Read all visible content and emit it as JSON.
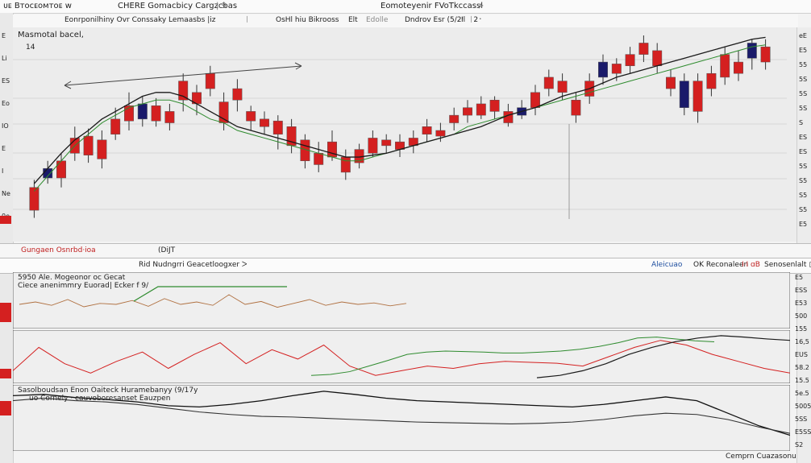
{
  "toolbar": {
    "left_title": "ᴜᴇ Bᴛoᴄᴇoᴍᴛoᴇ ᴡ",
    "center_title": "CHERE Gomacbicy Cargzcbas",
    "pager": "| 9",
    "right_title": "Eomoteyenir FVoTkccassl",
    "right_mark": "≯"
  },
  "header2": {
    "a": "Eonrponilhiny Ovr Conssaky Lemaasbs |iz",
    "b": "ᛁ",
    "c": "OsHl hiu Bikrooss",
    "d": "Elt",
    "e": "Edolle",
    "f": "Dndrov Esr (5/2ᶦ",
    "g": "Il",
    "h": "ᛁ2᛫"
  },
  "main_panel": {
    "label": "Masmotal bacel,",
    "sublabel": "14"
  },
  "sep1": {
    "left": "Gungaen Osnrbd·ioa",
    "mid": "(DiJT",
    "center": "Rid Nudngrri Geacetloogxer  ᐳ",
    "right_blue": "Aleicuao",
    "right_a": "OK Reconaleen",
    "right_b": "I·I ɑB",
    "right_c": "Senosenlalt ▢"
  },
  "sub1": {
    "label_a": "5950 Ale.  Mogeonor  oc  Gecat",
    "label_b": "Ciece  anenimmry Euorad|  Ecker f  9/"
  },
  "sub3": {
    "label_a": "Sasolboudsan Enon Oaiteck  Huramebanyy  (9/17y",
    "label_b": "uo Cornely  ·  cauvoboresanset Eauzpen",
    "footer": "Cemprn  Cuazasonu"
  },
  "right_axis": [
    "eE",
    "E5",
    "55",
    "5S",
    "5S",
    "5S",
    "S",
    "ES",
    "ES",
    "5S",
    "S5",
    "S5",
    "S5",
    "E5"
  ],
  "right_axis_lower": [
    "E5",
    "ESS",
    "E53",
    "500",
    "155",
    "16,5",
    "EUS",
    "58.2",
    "15.5",
    "5e.5",
    "5005",
    "5SS",
    "E5SS",
    "S2"
  ],
  "left_axis": [
    "E",
    "Li",
    "ES",
    "Eo",
    "IO",
    "E",
    "I",
    "Ne",
    "0e"
  ],
  "colors": {
    "bull": "#1a1a6a",
    "bear": "#d42020",
    "ma_black": "#1a1a1a",
    "ma_green": "#2e8b2e",
    "grid": "#bfbfbf",
    "panel_bg": "#ececec"
  },
  "chart_data": [
    {
      "type": "candlestick",
      "title": "",
      "xlabel": "",
      "ylabel": "",
      "ylim": [
        0,
        100
      ],
      "candles": [
        {
          "o": 8,
          "c": 20,
          "h": 24,
          "l": 4,
          "up": false
        },
        {
          "o": 30,
          "c": 25,
          "h": 34,
          "l": 22,
          "up": true
        },
        {
          "o": 25,
          "c": 34,
          "h": 38,
          "l": 20,
          "up": false
        },
        {
          "o": 38,
          "c": 46,
          "h": 52,
          "l": 34,
          "up": false
        },
        {
          "o": 47,
          "c": 37,
          "h": 51,
          "l": 33,
          "up": false
        },
        {
          "o": 35,
          "c": 45,
          "h": 50,
          "l": 30,
          "up": false
        },
        {
          "o": 48,
          "c": 56,
          "h": 62,
          "l": 45,
          "up": false
        },
        {
          "o": 55,
          "c": 63,
          "h": 70,
          "l": 50,
          "up": false
        },
        {
          "o": 64,
          "c": 56,
          "h": 68,
          "l": 52,
          "up": true
        },
        {
          "o": 55,
          "c": 63,
          "h": 67,
          "l": 52,
          "up": false
        },
        {
          "o": 60,
          "c": 54,
          "h": 64,
          "l": 50,
          "up": false
        },
        {
          "o": 66,
          "c": 76,
          "h": 80,
          "l": 60,
          "up": false
        },
        {
          "o": 70,
          "c": 64,
          "h": 74,
          "l": 58,
          "up": false
        },
        {
          "o": 72,
          "c": 80,
          "h": 84,
          "l": 68,
          "up": false
        },
        {
          "o": 54,
          "c": 65,
          "h": 70,
          "l": 50,
          "up": false
        },
        {
          "o": 66,
          "c": 72,
          "h": 77,
          "l": 60,
          "up": false
        },
        {
          "o": 60,
          "c": 55,
          "h": 63,
          "l": 50,
          "up": false
        },
        {
          "o": 56,
          "c": 52,
          "h": 60,
          "l": 48,
          "up": false
        },
        {
          "o": 55,
          "c": 48,
          "h": 58,
          "l": 40,
          "up": false
        },
        {
          "o": 42,
          "c": 52,
          "h": 56,
          "l": 38,
          "up": false
        },
        {
          "o": 45,
          "c": 34,
          "h": 48,
          "l": 30,
          "up": false
        },
        {
          "o": 38,
          "c": 32,
          "h": 44,
          "l": 28,
          "up": false
        },
        {
          "o": 44,
          "c": 36,
          "h": 50,
          "l": 34,
          "up": false
        },
        {
          "o": 36,
          "c": 28,
          "h": 40,
          "l": 24,
          "up": false
        },
        {
          "o": 40,
          "c": 33,
          "h": 43,
          "l": 30,
          "up": false
        },
        {
          "o": 38,
          "c": 46,
          "h": 50,
          "l": 36,
          "up": false
        },
        {
          "o": 42,
          "c": 45,
          "h": 48,
          "l": 38,
          "up": false
        },
        {
          "o": 44,
          "c": 40,
          "h": 48,
          "l": 36,
          "up": false
        },
        {
          "o": 46,
          "c": 42,
          "h": 50,
          "l": 38,
          "up": false
        },
        {
          "o": 48,
          "c": 52,
          "h": 56,
          "l": 44,
          "up": false
        },
        {
          "o": 50,
          "c": 47,
          "h": 54,
          "l": 44,
          "up": false
        },
        {
          "o": 54,
          "c": 58,
          "h": 62,
          "l": 50,
          "up": false
        },
        {
          "o": 58,
          "c": 62,
          "h": 66,
          "l": 54,
          "up": false
        },
        {
          "o": 64,
          "c": 58,
          "h": 68,
          "l": 56,
          "up": false
        },
        {
          "o": 66,
          "c": 60,
          "h": 68,
          "l": 56,
          "up": false
        },
        {
          "o": 60,
          "c": 54,
          "h": 64,
          "l": 52,
          "up": false
        },
        {
          "o": 62,
          "c": 58,
          "h": 66,
          "l": 56,
          "up": true
        },
        {
          "o": 62,
          "c": 70,
          "h": 74,
          "l": 58,
          "up": false
        },
        {
          "o": 72,
          "c": 78,
          "h": 82,
          "l": 68,
          "up": false
        },
        {
          "o": 76,
          "c": 70,
          "h": 80,
          "l": 66,
          "up": false
        },
        {
          "o": 66,
          "c": 58,
          "h": 70,
          "l": 54,
          "up": false
        },
        {
          "o": 68,
          "c": 76,
          "h": 80,
          "l": 64,
          "up": false
        },
        {
          "o": 78,
          "c": 86,
          "h": 90,
          "l": 74,
          "up": true
        },
        {
          "o": 85,
          "c": 80,
          "h": 88,
          "l": 76,
          "up": false
        },
        {
          "o": 84,
          "c": 90,
          "h": 94,
          "l": 80,
          "up": false
        },
        {
          "o": 90,
          "c": 96,
          "h": 100,
          "l": 86,
          "up": false
        },
        {
          "o": 92,
          "c": 84,
          "h": 96,
          "l": 80,
          "up": false
        },
        {
          "o": 78,
          "c": 72,
          "h": 82,
          "l": 68,
          "up": false
        },
        {
          "o": 76,
          "c": 62,
          "h": 80,
          "l": 58,
          "up": true
        },
        {
          "o": 76,
          "c": 60,
          "h": 80,
          "l": 54,
          "up": false
        },
        {
          "o": 80,
          "c": 72,
          "h": 84,
          "l": 68,
          "up": false
        },
        {
          "o": 78,
          "c": 90,
          "h": 94,
          "l": 74,
          "up": false
        },
        {
          "o": 86,
          "c": 80,
          "h": 92,
          "l": 76,
          "up": false
        },
        {
          "o": 88,
          "c": 96,
          "h": 98,
          "l": 82,
          "up": true
        },
        {
          "o": 94,
          "c": 86,
          "h": 98,
          "l": 82,
          "up": false
        }
      ],
      "ma_black": [
        22,
        30,
        38,
        45,
        50,
        56,
        60,
        64,
        68,
        70,
        70,
        68,
        64,
        60,
        56,
        52,
        50,
        48,
        46,
        44,
        42,
        40,
        38,
        36,
        36,
        37,
        38,
        40,
        42,
        44,
        46,
        48,
        50,
        52,
        55,
        58,
        60,
        62,
        65,
        68,
        70,
        72,
        75,
        78,
        80,
        82,
        84,
        86,
        88,
        90,
        92,
        94,
        96,
        98,
        99
      ],
      "ma_green": [
        18,
        26,
        34,
        42,
        48,
        54,
        58,
        62,
        64,
        66,
        66,
        64,
        60,
        56,
        54,
        50,
        48,
        46,
        44,
        42,
        40,
        38,
        36,
        34,
        34,
        36,
        38,
        40,
        42,
        44,
        46,
        48,
        52,
        54,
        56,
        58,
        60,
        62,
        64,
        66,
        68,
        70,
        72,
        74,
        76,
        78,
        80,
        82,
        84,
        86,
        88,
        90,
        92,
        94,
        95
      ]
    },
    {
      "type": "line",
      "title": "",
      "ylim": [
        0,
        100
      ],
      "series": [
        {
          "values": [
            50,
            55,
            48,
            60,
            45,
            52,
            50,
            58,
            46,
            62,
            50,
            55,
            48,
            70,
            50,
            56,
            44,
            52,
            60,
            48,
            55,
            50,
            53,
            47,
            52
          ]
        }
      ]
    },
    {
      "type": "line",
      "title": "",
      "ylim": [
        0,
        100
      ],
      "series": [
        {
          "values": [
            20,
            70,
            35,
            15,
            40,
            60,
            25,
            55,
            80,
            35,
            65,
            45,
            75,
            30,
            10,
            20,
            30,
            25,
            35,
            40,
            38,
            36,
            30,
            50,
            70,
            85,
            75,
            55,
            40,
            25,
            15
          ]
        },
        {
          "values": [
            10,
            12,
            18,
            30,
            42,
            55,
            60,
            62,
            61,
            60,
            58,
            58,
            60,
            62,
            66,
            72,
            80,
            90,
            92,
            88,
            84,
            82
          ]
        },
        {
          "values": [
            5,
            10,
            20,
            35,
            55,
            70,
            82,
            90,
            95,
            92,
            88,
            85
          ]
        }
      ]
    },
    {
      "type": "line",
      "title": "",
      "ylim": [
        0,
        100
      ],
      "series": [
        {
          "values": [
            88,
            90,
            85,
            82,
            78,
            72,
            70,
            74,
            80,
            88,
            95,
            90,
            84,
            80,
            78,
            76,
            74,
            72,
            70,
            74,
            80,
            86,
            80,
            60,
            40,
            25
          ]
        },
        {
          "values": [
            80,
            84,
            80,
            78,
            74,
            68,
            62,
            58,
            55,
            54,
            52,
            50,
            48,
            46,
            45,
            44,
            43,
            44,
            46,
            50,
            56,
            60,
            58,
            50,
            38,
            28
          ]
        }
      ]
    }
  ]
}
